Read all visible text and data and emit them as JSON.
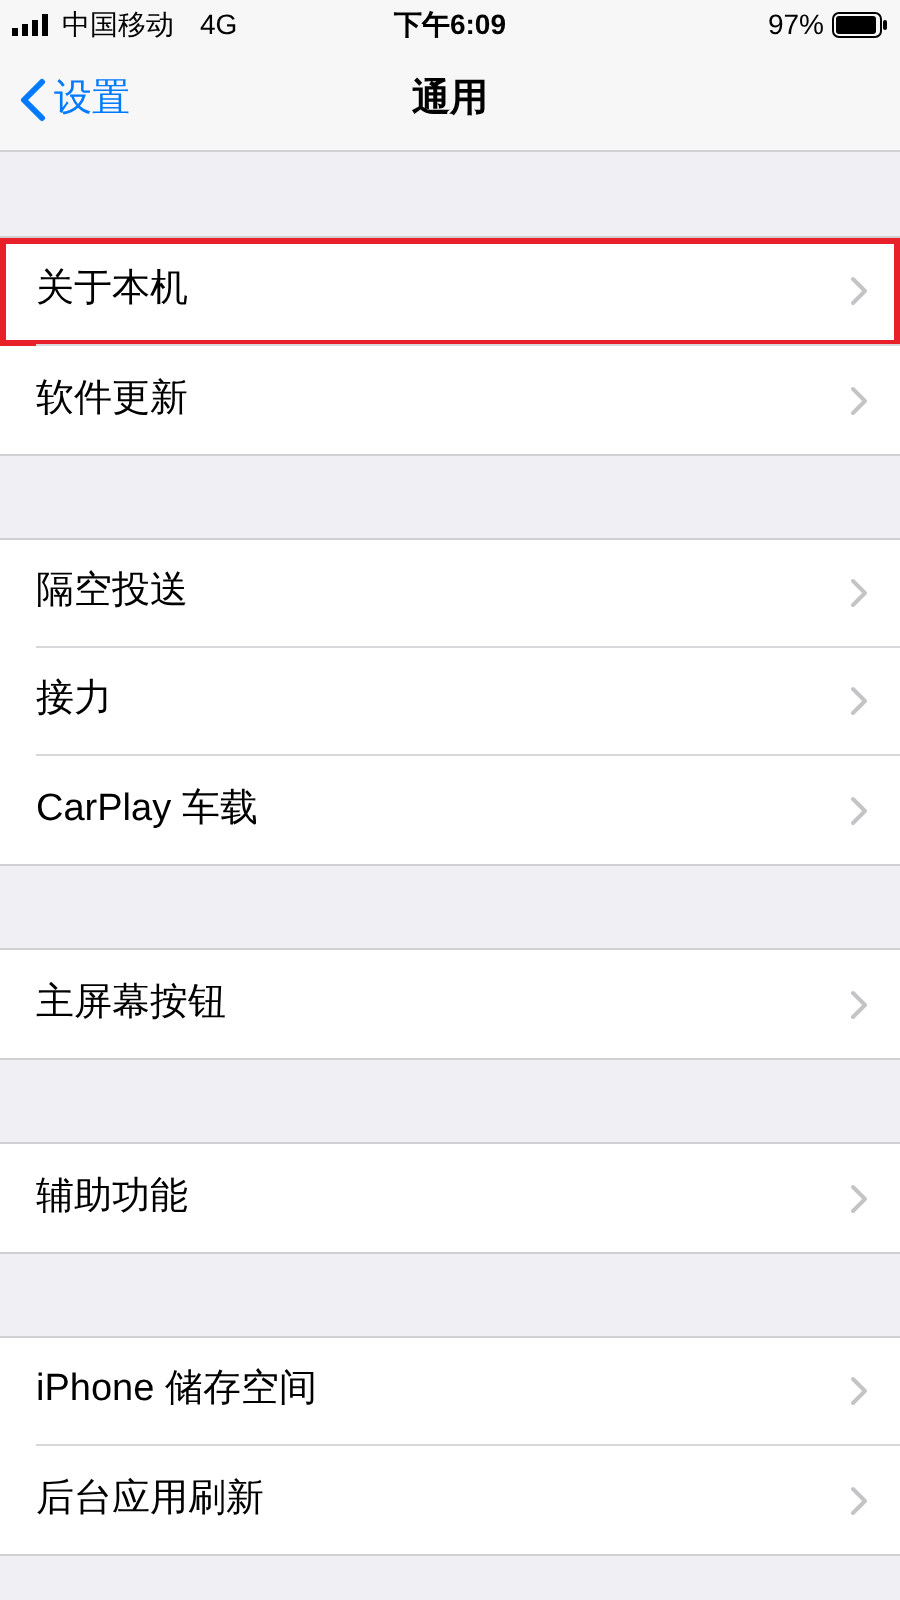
{
  "status_bar": {
    "carrier": "中国移动",
    "network": "4G",
    "time": "下午6:09",
    "battery": "97%"
  },
  "nav": {
    "back": "设置",
    "title": "通用"
  },
  "groups": [
    {
      "items": [
        {
          "label": "关于本机",
          "highlighted": true
        },
        {
          "label": "软件更新",
          "highlighted": false
        }
      ]
    },
    {
      "items": [
        {
          "label": "隔空投送",
          "highlighted": false
        },
        {
          "label": "接力",
          "highlighted": false
        },
        {
          "label": "CarPlay 车载",
          "highlighted": false
        }
      ]
    },
    {
      "items": [
        {
          "label": "主屏幕按钮",
          "highlighted": false
        }
      ]
    },
    {
      "items": [
        {
          "label": "辅助功能",
          "highlighted": false
        }
      ]
    },
    {
      "items": [
        {
          "label": "iPhone 储存空间",
          "highlighted": false
        },
        {
          "label": "后台应用刷新",
          "highlighted": false
        }
      ]
    }
  ]
}
